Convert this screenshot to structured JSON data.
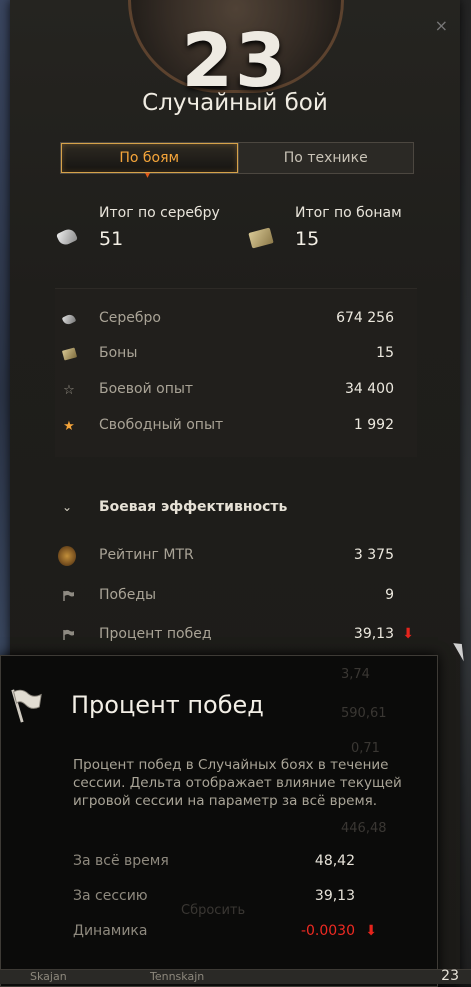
{
  "header": {
    "battles_count": "23",
    "battle_type": "Случайный бой",
    "close_icon": "×"
  },
  "tabs": [
    {
      "label": "По боям",
      "active": true
    },
    {
      "label": "По технике",
      "active": false
    }
  ],
  "summary": {
    "silver": {
      "label": "Итог по серебру",
      "value": "51",
      "icon": "silver-icon"
    },
    "bonds": {
      "label": "Итог по бонам",
      "value": "15",
      "icon": "bonds-icon"
    }
  },
  "resources": [
    {
      "icon": "silver-icon",
      "label": "Серебро",
      "value": "674 256"
    },
    {
      "icon": "bonds-icon",
      "label": "Боны",
      "value": "15"
    },
    {
      "icon": "star-icon",
      "label": "Боевой опыт",
      "value": "34 400"
    },
    {
      "icon": "gold-star-icon",
      "label": "Свободный опыт",
      "value": "1 992"
    }
  ],
  "efficiency": {
    "title": "Боевая эффективность",
    "rows": [
      {
        "icon": "mtr-rating-icon",
        "label": "Рейтинг MTR",
        "value": "3 375",
        "trend": ""
      },
      {
        "icon": "flag-icon",
        "label": "Победы",
        "value": "9",
        "trend": ""
      },
      {
        "icon": "flag-icon",
        "label": "Процент побед",
        "value": "39,13",
        "trend": "down"
      }
    ],
    "obscured_values": [
      "3,74",
      "590,61",
      "0,71",
      "446,48"
    ]
  },
  "tooltip": {
    "title": "Процент побед",
    "description": "Процент побед в Случайных боях в течение сессии. Дельта отображает влияние текущей игровой сессии на параметр за всё время.",
    "rows": [
      {
        "label": "За всё время",
        "value": "48,42",
        "negative": false,
        "trend": ""
      },
      {
        "label": "За сессию",
        "value": "39,13",
        "negative": false,
        "trend": ""
      },
      {
        "label": "Динамика",
        "value": "-0.0030",
        "negative": true,
        "trend": "down"
      }
    ],
    "reset_button": "Сбросить"
  },
  "taskbar": {
    "items": [
      "Skajan",
      "Tennskajn"
    ],
    "counter": "23"
  },
  "colors": {
    "accent": "#f5a53a",
    "negative": "#e6241c",
    "text_primary": "#ece8de",
    "text_secondary": "#a9a396"
  }
}
